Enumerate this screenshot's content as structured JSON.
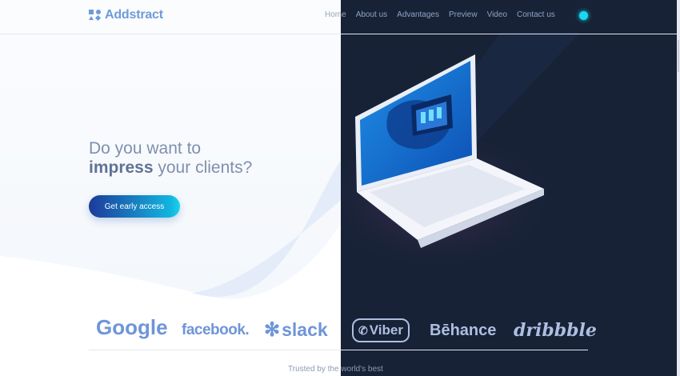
{
  "brand": {
    "name": "Addstract"
  },
  "nav": {
    "items": [
      {
        "label": "Home"
      },
      {
        "label": "About us"
      },
      {
        "label": "Advantages"
      },
      {
        "label": "Preview"
      },
      {
        "label": "Video"
      },
      {
        "label": "Contact us"
      }
    ],
    "theme_toggle_color": "#18d8ef"
  },
  "hero": {
    "line1": "Do you want to",
    "highlight": "impress",
    "line2_rest": " your clients?",
    "cta_label": "Get early access"
  },
  "partners": {
    "logos": [
      "Google",
      "facebook.",
      "slack",
      "Viber",
      "Bēhance",
      "dribbble"
    ],
    "caption": "Trusted by the world's best"
  },
  "colors": {
    "accent": "#6e9bd8",
    "dark_panel": "#172237",
    "cta_gradient_start": "#1d3a9a",
    "cta_gradient_end": "#18d4ea"
  }
}
